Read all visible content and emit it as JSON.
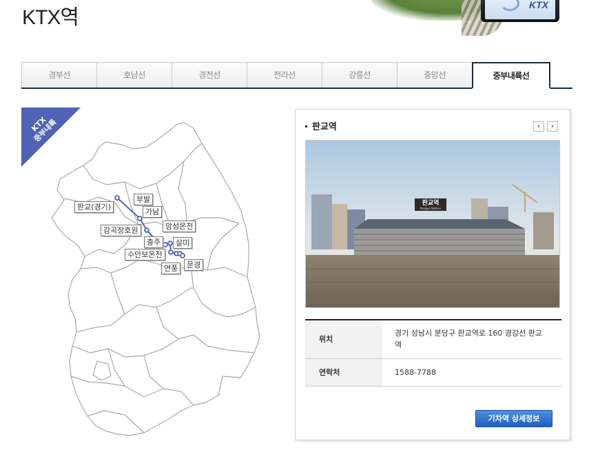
{
  "page": {
    "title": "KTX역"
  },
  "header_art": {
    "logo": "KTX"
  },
  "tabs": [
    {
      "label": "경부선",
      "active": false
    },
    {
      "label": "호남선",
      "active": false
    },
    {
      "label": "경전선",
      "active": false
    },
    {
      "label": "전라선",
      "active": false
    },
    {
      "label": "강릉선",
      "active": false
    },
    {
      "label": "중앙선",
      "active": false
    },
    {
      "label": "중부내륙선",
      "active": true
    }
  ],
  "ribbon": {
    "line1": "KTX",
    "line2": "중부내륙"
  },
  "map": {
    "line_color": "#4f62b6",
    "stations": [
      {
        "name": "판교(경기)"
      },
      {
        "name": "부발"
      },
      {
        "name": "가남"
      },
      {
        "name": "감곡장호원"
      },
      {
        "name": "앙성온천"
      },
      {
        "name": "충주"
      },
      {
        "name": "살미"
      },
      {
        "name": "수안보온천"
      },
      {
        "name": "연풍"
      },
      {
        "name": "문경"
      }
    ]
  },
  "panel": {
    "station_name": "판교역",
    "prev_icon": "chevron-left-icon",
    "next_icon": "chevron-right-icon",
    "photo_sign": "판교역",
    "photo_sign_sub": "Pangyo Station",
    "rows": [
      {
        "label": "위치",
        "value": "경기 성남시 분당구 판교역로 160 경강선 판교역"
      },
      {
        "label": "연락처",
        "value": "1588-7788"
      }
    ],
    "detail_button": "기차역 상세정보"
  },
  "colors": {
    "accent": "#1f5fbf",
    "ribbon": "#4f62b6",
    "tab_border": "#1a2a3a"
  }
}
